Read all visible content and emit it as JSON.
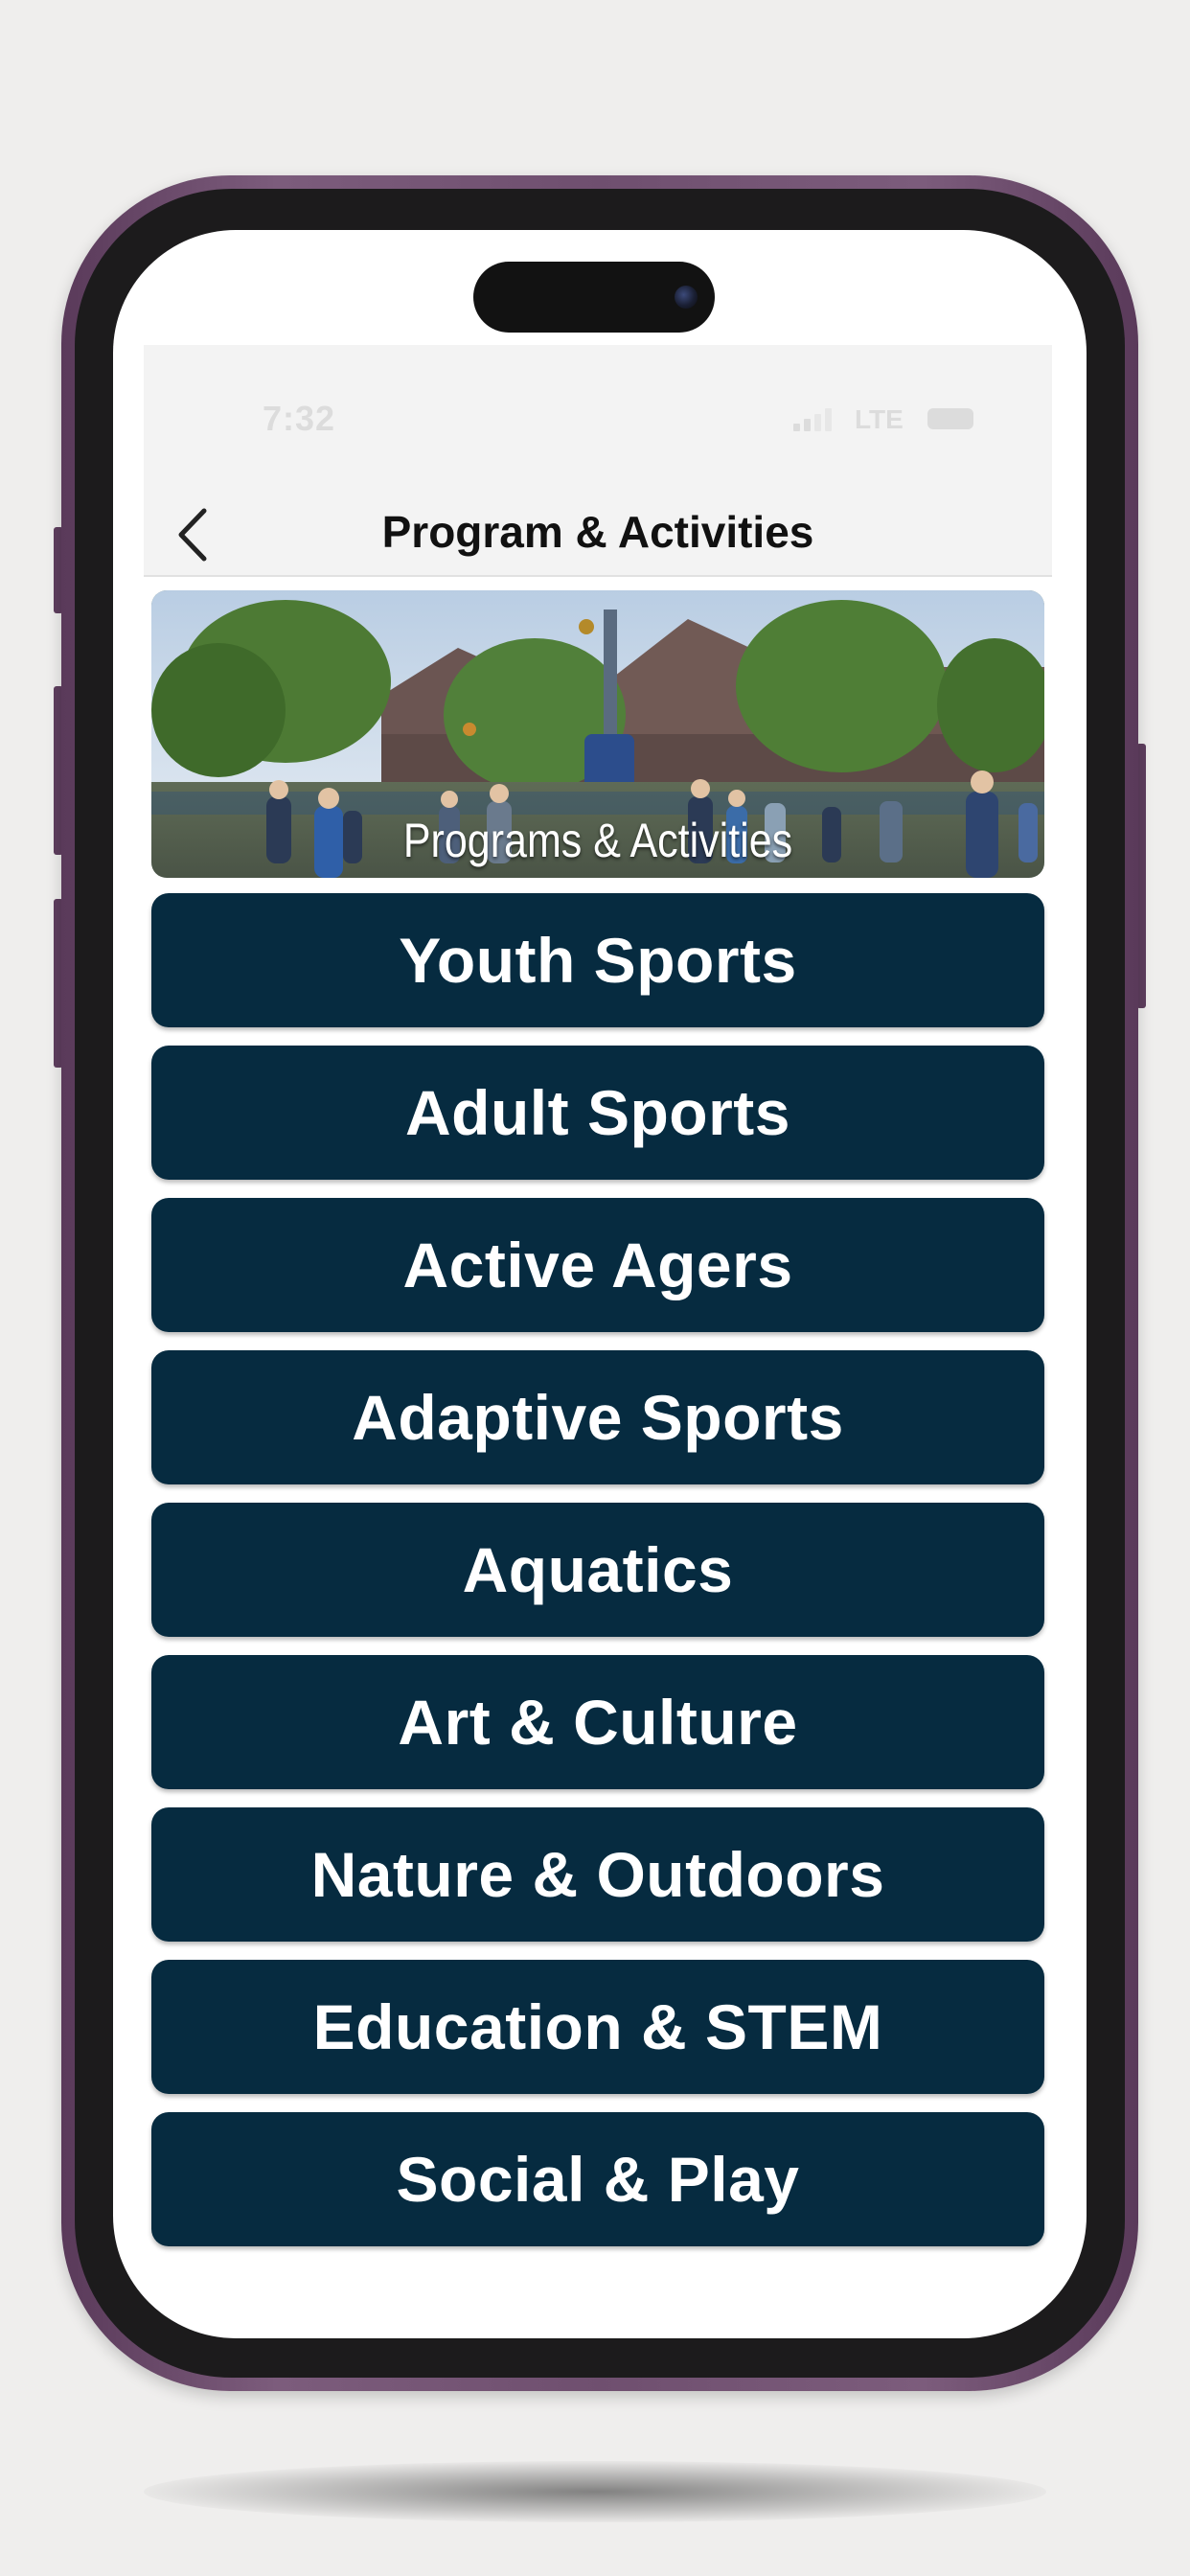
{
  "status_bar": {
    "time": "7:32",
    "network": "LTE",
    "icons": [
      "signal-icon",
      "battery-icon"
    ]
  },
  "nav": {
    "title": "Program & Activities",
    "back_icon": "chevron-left-icon"
  },
  "banner": {
    "caption": "Programs & Activities"
  },
  "menu": {
    "items": [
      {
        "label": "Youth Sports"
      },
      {
        "label": "Adult Sports"
      },
      {
        "label": "Active Agers"
      },
      {
        "label": "Adaptive Sports"
      },
      {
        "label": "Aquatics"
      },
      {
        "label": "Art & Culture"
      },
      {
        "label": "Nature & Outdoors"
      },
      {
        "label": "Education & STEM"
      },
      {
        "label": "Social & Play"
      }
    ]
  },
  "colors": {
    "button_background": "#062b40",
    "button_text": "#ffffff",
    "navbar_background": "#f3f3f3",
    "device_frame": "#6f4f6f",
    "page_background": "#efeeed"
  }
}
